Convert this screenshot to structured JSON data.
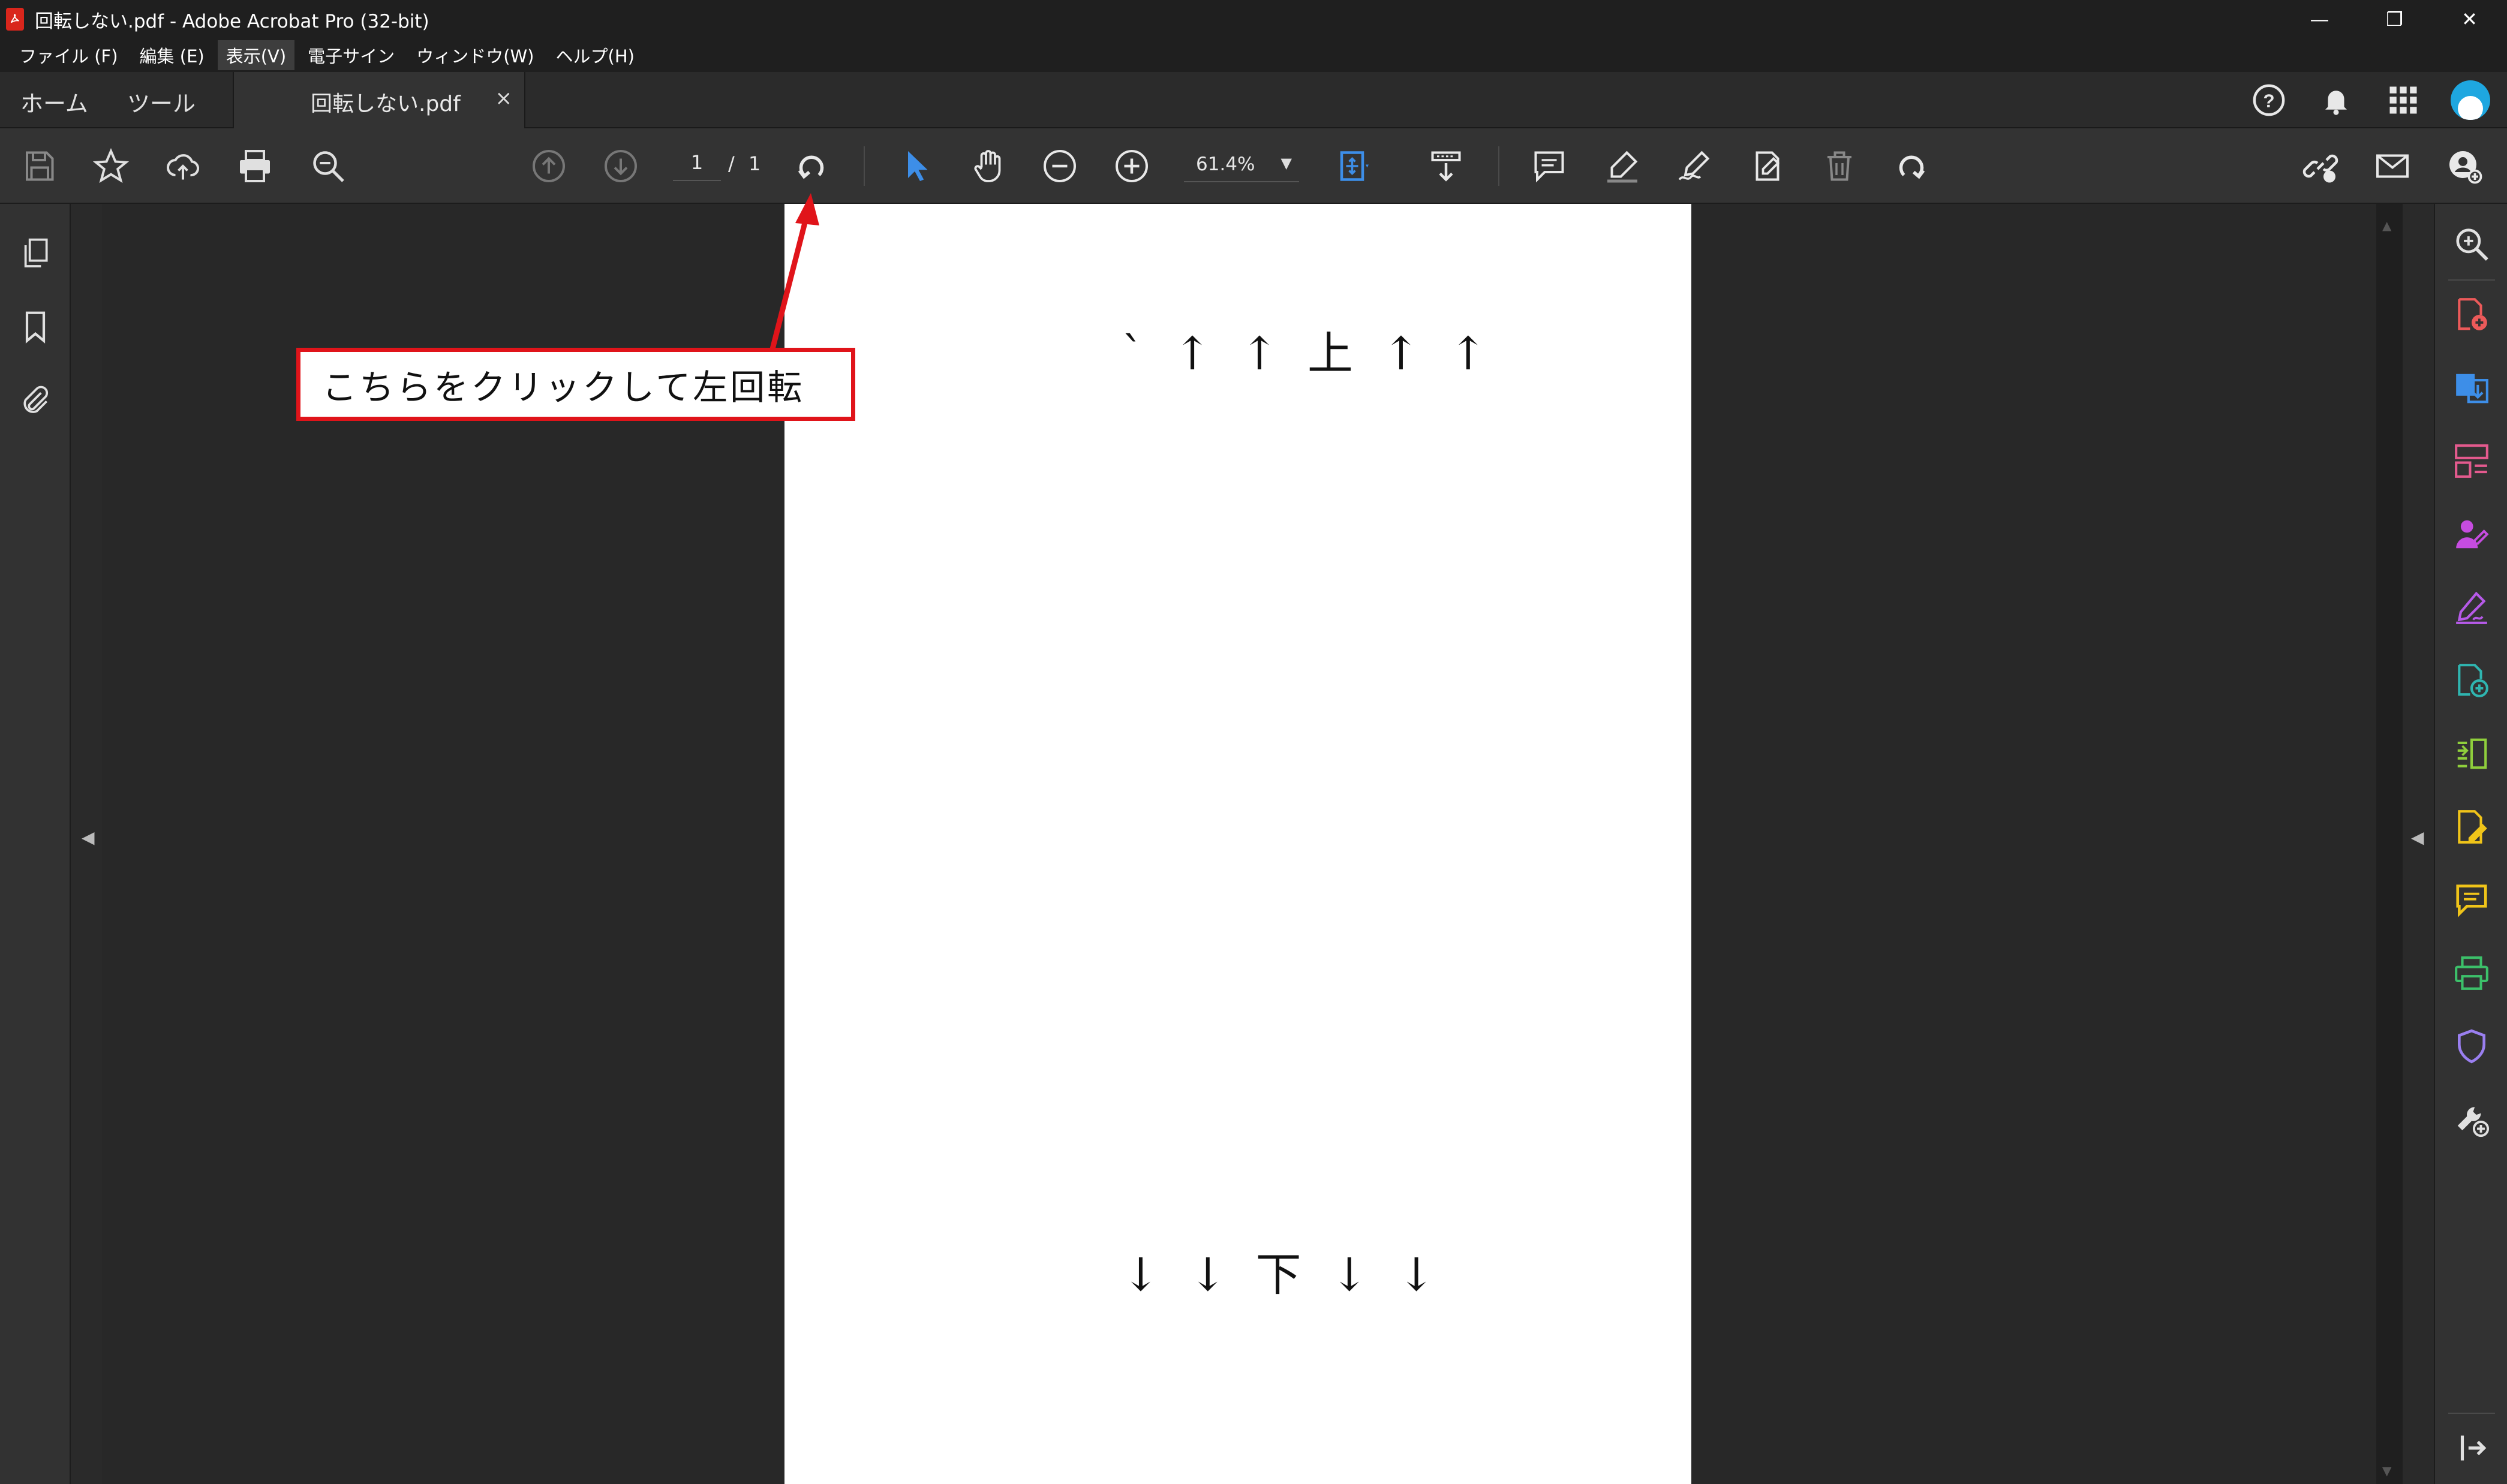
{
  "window": {
    "title": "回転しない.pdf - Adobe Acrobat Pro (32-bit)",
    "controls": [
      "minimize-icon",
      "restore-icon",
      "close-icon"
    ]
  },
  "menu": {
    "items": [
      "ファイル (F)",
      "編集 (E)",
      "表示(V)",
      "電子サイン",
      "ウィンドウ(W)",
      "ヘルプ(H)"
    ],
    "active": "表示(V)"
  },
  "tabs": {
    "home": "ホーム",
    "tools": "ツール",
    "document": "回転しない.pdf",
    "close": "×"
  },
  "toolbar": {
    "page_current": "1",
    "page_separator": "/",
    "page_total": "1",
    "zoom": "61.4%",
    "icons": [
      "save-icon",
      "bookmark-star-icon",
      "upload-cloud-icon",
      "print-icon",
      "search-zoom-icon",
      "page-up-icon",
      "page-down-icon",
      "rotate-left-icon",
      "select-cursor-icon",
      "hand-icon",
      "zoom-out-icon",
      "zoom-in-icon",
      "fit-page-icon",
      "scroll-mode-icon",
      "comment-icon",
      "highlight-icon",
      "sign-icon",
      "edit-page-icon",
      "delete-icon",
      "rotate-right-icon",
      "link-icon",
      "email-icon",
      "share-user-icon"
    ]
  },
  "document": {
    "top_text": "` ↑ ↑ 上 ↑ ↑",
    "bottom_text": "↓ ↓ 下 ↓ ↓"
  },
  "annotation": {
    "text": "こちらをクリックして左回転",
    "color": "#e0141a"
  },
  "colors": {
    "accent_blue": "#3d8ee8",
    "avatar": "#1ea7e0"
  }
}
